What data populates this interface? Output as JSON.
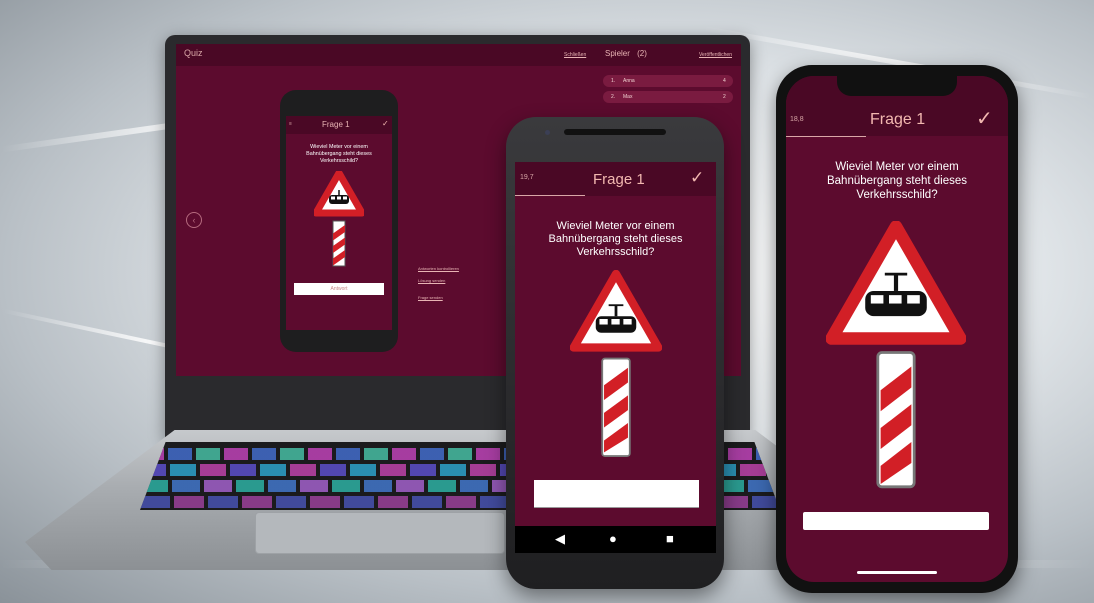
{
  "laptop": {
    "app_title": "Quiz",
    "link_schliessen": "Schließen",
    "link_veroeffentlichen": "Veröffentlichen",
    "players_title": "Spieler",
    "players_count": "(2)",
    "players": [
      {
        "rank": "1.",
        "name": "Anna",
        "score": "4"
      },
      {
        "rank": "2.",
        "name": "Max",
        "score": "2"
      }
    ],
    "side_links": [
      "Antworten kontrollieren",
      "Lösung senden",
      "Frage senden"
    ],
    "small_phone": {
      "question_title": "Frage 1",
      "question": "Wieviel Meter vor einem Bahnübergang steht dieses Verkehrsschild?",
      "answer_placeholder": "Antwort"
    }
  },
  "android": {
    "timer": "19,7",
    "question_title": "Frage 1",
    "question": "Wieviel Meter vor einem Bahnübergang steht dieses Verkehrsschild?",
    "check_icon": "checkmark-icon",
    "nav": {
      "back": "◀",
      "home": "●",
      "recent": "■"
    }
  },
  "iphone": {
    "timer": "18,8",
    "question_title": "Frage 1",
    "question": "Wieviel Meter vor einem Bahnübergang steht dieses Verkehrsschild?",
    "check_icon": "checkmark-icon"
  },
  "colors": {
    "app_background": "#5c0b2e",
    "header_background": "#4a0825",
    "accent_text": "#f2b8b0",
    "sign_red": "#d21f26"
  }
}
